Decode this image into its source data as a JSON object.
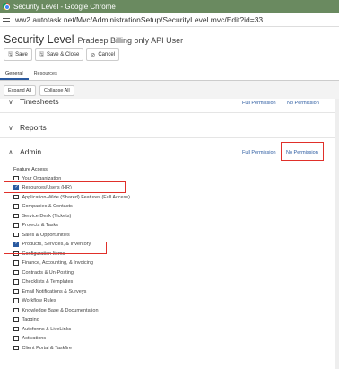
{
  "window": {
    "title": "Security Level - Google Chrome"
  },
  "browser": {
    "url": "ww2.autotask.net/Mvc/AdministrationSetup/SecurityLevel.mvc/Edit?id=33"
  },
  "page": {
    "title": "Security Level",
    "subtitle": "Pradeep Billing only API User"
  },
  "toolbar": {
    "save": "Save",
    "save_close": "Save & Close",
    "cancel": "Cancel"
  },
  "tabs": [
    "General",
    "Resources"
  ],
  "expand": {
    "expand_all": "Expand All",
    "collapse_all": "Collapse All"
  },
  "sections": {
    "timesheets": "Timesheets",
    "reports": "Reports",
    "admin": "Admin"
  },
  "permissions": {
    "full": "Full Permission",
    "none": "No Permission"
  },
  "feature_access_label": "Feature Access",
  "features": [
    {
      "label": "Your Organization",
      "checked": false
    },
    {
      "label": "Resources/Users (HR)",
      "checked": true
    },
    {
      "label": "Application-Wide (Shared) Features (Full Access)",
      "checked": false
    },
    {
      "label": "Companies & Contacts",
      "checked": false
    },
    {
      "label": "Service Desk (Tickets)",
      "checked": false
    },
    {
      "label": "Projects & Tasks",
      "checked": false
    },
    {
      "label": "Sales & Opportunities",
      "checked": false
    },
    {
      "label": "Products, Services, & Inventory",
      "checked": true
    },
    {
      "label": "Configuration Items",
      "checked": false
    },
    {
      "label": "Finance, Accounting, & Invoicing",
      "checked": false
    },
    {
      "label": "Contracts & Un-Posting",
      "checked": false
    },
    {
      "label": "Checklists & Templates",
      "checked": false
    },
    {
      "label": "Email Notifications & Surveys",
      "checked": false
    },
    {
      "label": "Workflow Rules",
      "checked": false
    },
    {
      "label": "Knowledge Base & Documentation",
      "checked": false
    },
    {
      "label": "Tagging",
      "checked": false
    },
    {
      "label": "Autoforms & LiveLinks",
      "checked": false
    },
    {
      "label": "Activations",
      "checked": false
    },
    {
      "label": "Client Portal & Taskfire",
      "checked": false
    }
  ]
}
